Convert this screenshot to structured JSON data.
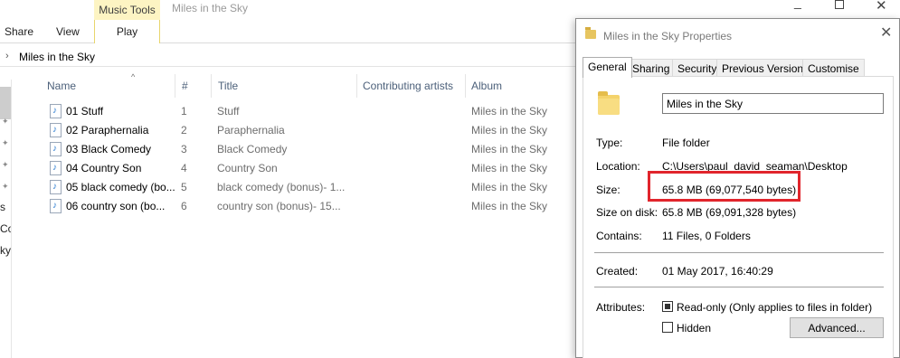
{
  "ribbon": {
    "tabs": [
      "Share",
      "View"
    ],
    "contextual_group_label": "Music Tools",
    "contextual_tab": "Play",
    "window_title": "Miles in the Sky"
  },
  "address": {
    "crumb": "Miles in the Sky"
  },
  "navpane": {
    "partial_labels": [
      "s",
      "Coll",
      "ky"
    ]
  },
  "columns": [
    "Name",
    "#",
    "Title",
    "Contributing artists",
    "Album"
  ],
  "files": [
    {
      "name": "01 Stuff",
      "num": "1",
      "title": "Stuff",
      "album": "Miles in the Sky"
    },
    {
      "name": "02 Paraphernalia",
      "num": "2",
      "title": "Paraphernalia",
      "album": "Miles in the Sky"
    },
    {
      "name": "03 Black Comedy",
      "num": "3",
      "title": "Black Comedy",
      "album": "Miles in the Sky"
    },
    {
      "name": "04 Country Son",
      "num": "4",
      "title": "Country Son",
      "album": "Miles in the Sky"
    },
    {
      "name": "05 black comedy (bo...",
      "num": "5",
      "title": "black comedy (bonus)- 1...",
      "album": "Miles in the Sky"
    },
    {
      "name": "06 country son (bo...",
      "num": "6",
      "title": "country son (bonus)- 15...",
      "album": "Miles in the Sky"
    }
  ],
  "dialog": {
    "title": "Miles in the Sky Properties",
    "tabs": [
      "General",
      "Sharing",
      "Security",
      "Previous Versions",
      "Customise"
    ],
    "folder_name": "Miles in the Sky",
    "type_label": "Type:",
    "type_value": "File folder",
    "location_label": "Location:",
    "location_value": "C:\\Users\\paul_david_seaman\\Desktop",
    "size_label": "Size:",
    "size_value": "65.8 MB (69,077,540 bytes)",
    "size_on_disk_label": "Size on disk:",
    "size_on_disk_value": "65.8 MB (69,091,328 bytes)",
    "contains_label": "Contains:",
    "contains_value": "11 Files, 0 Folders",
    "created_label": "Created:",
    "created_value": "01 May 2017, 16:40:29",
    "attributes_label": "Attributes:",
    "readonly_label": "Read-only (Only applies to files in folder)",
    "hidden_label": "Hidden",
    "advanced_button": "Advanced..."
  },
  "colors": {
    "highlight": "#e1252c",
    "contextual": "#fdf4c3",
    "header_text": "#4c607a"
  }
}
